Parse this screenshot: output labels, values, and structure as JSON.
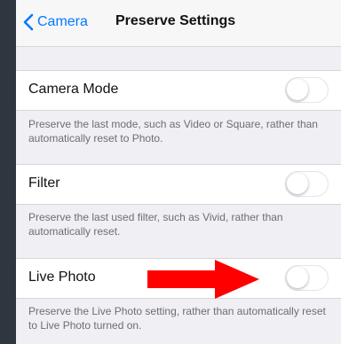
{
  "nav": {
    "back_label": "Camera",
    "title": "Preserve Settings"
  },
  "settings": [
    {
      "label": "Camera Mode",
      "enabled": false,
      "description": "Preserve the last mode, such as Video or Square, rather than automatically reset to Photo."
    },
    {
      "label": "Filter",
      "enabled": false,
      "description": "Preserve the last used filter, such as Vivid, rather than automatically reset."
    },
    {
      "label": "Live Photo",
      "enabled": false,
      "description": "Preserve the Live Photo setting, rather than automatically reset to Live Photo turned on."
    }
  ],
  "colors": {
    "accent": "#007aff",
    "annotation_arrow": "#ff0000"
  },
  "icons": {
    "back": "chevron-left-icon",
    "annotation": "arrow-right-icon"
  }
}
